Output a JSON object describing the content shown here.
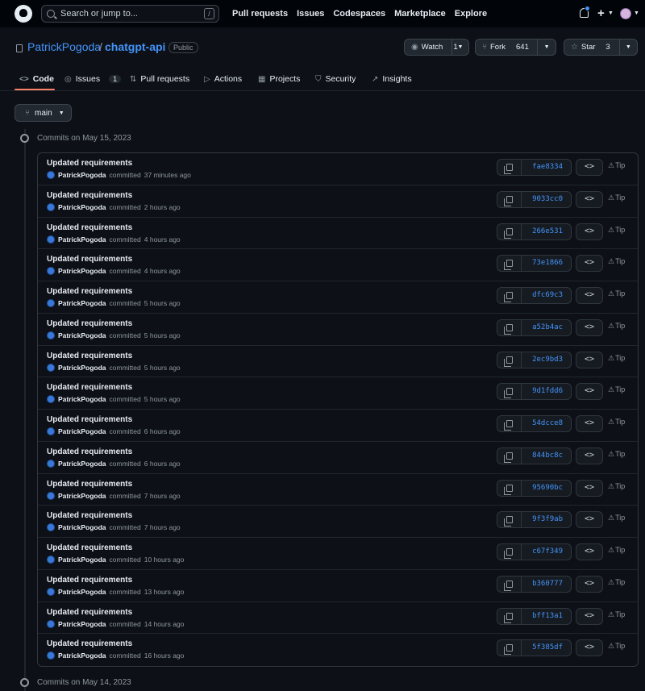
{
  "header": {
    "search_placeholder": "Search or jump to...",
    "search_shortcut": "/",
    "nav": [
      "Pull requests",
      "Issues",
      "Codespaces",
      "Marketplace",
      "Explore"
    ],
    "plus_label": "+"
  },
  "repo": {
    "owner": "PatrickPogoda",
    "separator": "/",
    "name": "chatgpt-api",
    "visibility": "Public",
    "watch": {
      "label": "Watch",
      "count": "1"
    },
    "fork": {
      "label": "Fork",
      "count": "641"
    },
    "star": {
      "label": "Star",
      "count": "3"
    }
  },
  "tabs": {
    "code": "Code",
    "issues": "Issues",
    "issues_count": "1",
    "pulls": "Pull requests",
    "actions": "Actions",
    "projects": "Projects",
    "security": "Security",
    "insights": "Insights"
  },
  "branch": "main",
  "groups": {
    "first": "Commits on May 15, 2023",
    "second": "Commits on May 14, 2023"
  },
  "commits": [
    {
      "title": "Updated requirements",
      "author": "PatrickPogoda",
      "verb": "committed",
      "time": "37 minutes ago",
      "sha": "fae8334"
    },
    {
      "title": "Updated requirements",
      "author": "PatrickPogoda",
      "verb": "committed",
      "time": "2 hours ago",
      "sha": "9033cc0"
    },
    {
      "title": "Updated requirements",
      "author": "PatrickPogoda",
      "verb": "committed",
      "time": "4 hours ago",
      "sha": "266e531"
    },
    {
      "title": "Updated requirements",
      "author": "PatrickPogoda",
      "verb": "committed",
      "time": "4 hours ago",
      "sha": "73e1866"
    },
    {
      "title": "Updated requirements",
      "author": "PatrickPogoda",
      "verb": "committed",
      "time": "5 hours ago",
      "sha": "dfc69c3"
    },
    {
      "title": "Updated requirements",
      "author": "PatrickPogoda",
      "verb": "committed",
      "time": "5 hours ago",
      "sha": "a52b4ac"
    },
    {
      "title": "Updated requirements",
      "author": "PatrickPogoda",
      "verb": "committed",
      "time": "5 hours ago",
      "sha": "2ec9bd3"
    },
    {
      "title": "Updated requirements",
      "author": "PatrickPogoda",
      "verb": "committed",
      "time": "5 hours ago",
      "sha": "9d1fdd6"
    },
    {
      "title": "Updated requirements",
      "author": "PatrickPogoda",
      "verb": "committed",
      "time": "6 hours ago",
      "sha": "54dcce8"
    },
    {
      "title": "Updated requirements",
      "author": "PatrickPogoda",
      "verb": "committed",
      "time": "6 hours ago",
      "sha": "844bc8c"
    },
    {
      "title": "Updated requirements",
      "author": "PatrickPogoda",
      "verb": "committed",
      "time": "7 hours ago",
      "sha": "95690bc"
    },
    {
      "title": "Updated requirements",
      "author": "PatrickPogoda",
      "verb": "committed",
      "time": "7 hours ago",
      "sha": "9f3f9ab"
    },
    {
      "title": "Updated requirements",
      "author": "PatrickPogoda",
      "verb": "committed",
      "time": "10 hours ago",
      "sha": "c67f349"
    },
    {
      "title": "Updated requirements",
      "author": "PatrickPogoda",
      "verb": "committed",
      "time": "13 hours ago",
      "sha": "b360777"
    },
    {
      "title": "Updated requirements",
      "author": "PatrickPogoda",
      "verb": "committed",
      "time": "14 hours ago",
      "sha": "bff13a1"
    },
    {
      "title": "Updated requirements",
      "author": "PatrickPogoda",
      "verb": "committed",
      "time": "16 hours ago",
      "sha": "5f385df"
    }
  ],
  "row_actions": {
    "browse_label": "<>",
    "tip_label": "Tip"
  },
  "icons": {
    "logo": "github-logo-icon",
    "search": "search-icon",
    "notifications": "bell-icon",
    "repo": "repo-icon",
    "copy": "copy-icon",
    "browse": "code-icon",
    "tip": "alert-icon",
    "commit": "commit-node-icon"
  },
  "colors": {
    "background": "#0d1117",
    "header_background": "#010409",
    "link": "#4493f8",
    "active_tab_underline": "#f78166",
    "muted_text": "#9198a1"
  }
}
